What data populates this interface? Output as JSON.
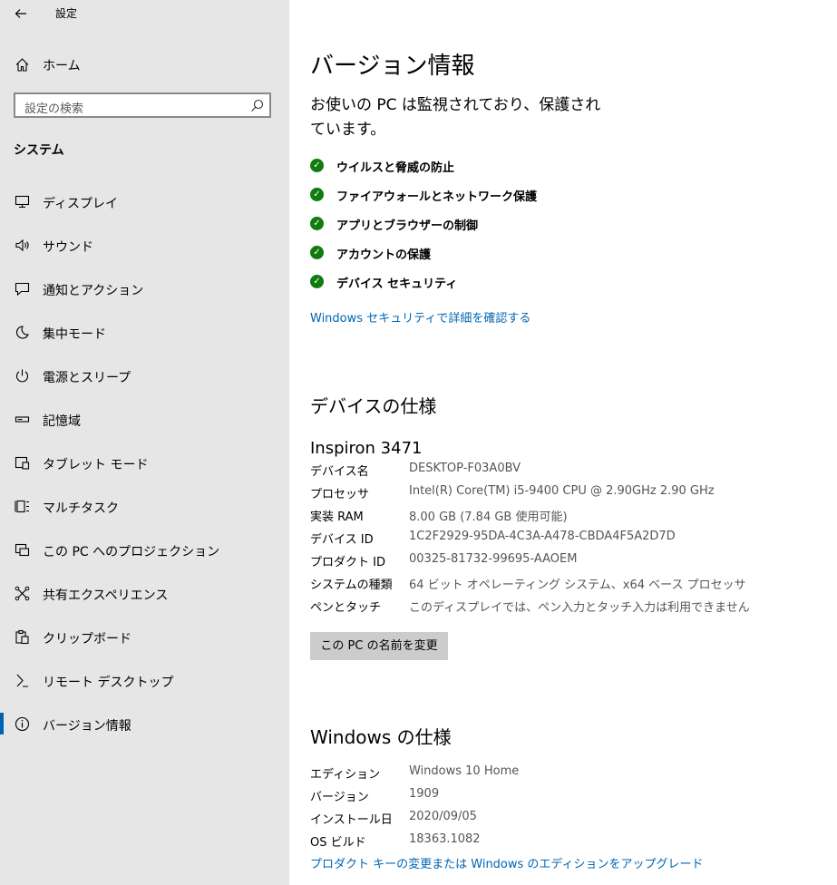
{
  "window": {
    "title": "設定"
  },
  "sidebar": {
    "home_label": "ホーム",
    "search_placeholder": "設定の検索",
    "section": "システム",
    "items": [
      {
        "label": "ディスプレイ",
        "icon": "display-icon"
      },
      {
        "label": "サウンド",
        "icon": "speaker-icon"
      },
      {
        "label": "通知とアクション",
        "icon": "notification-icon"
      },
      {
        "label": "集中モード",
        "icon": "moon-icon"
      },
      {
        "label": "電源とスリープ",
        "icon": "power-icon"
      },
      {
        "label": "記憶域",
        "icon": "storage-icon"
      },
      {
        "label": "タブレット モード",
        "icon": "tablet-icon"
      },
      {
        "label": "マルチタスク",
        "icon": "multitask-icon"
      },
      {
        "label": "この PC へのプロジェクション",
        "icon": "projection-icon"
      },
      {
        "label": "共有エクスペリエンス",
        "icon": "share-icon"
      },
      {
        "label": "クリップボード",
        "icon": "clipboard-icon"
      },
      {
        "label": "リモート デスクトップ",
        "icon": "remote-icon"
      },
      {
        "label": "バージョン情報",
        "icon": "info-icon",
        "active": true
      }
    ]
  },
  "main": {
    "title": "バージョン情報",
    "protection_line1": "お使いの PC は監視されており、保護され",
    "protection_line2": "ています。",
    "security_items": [
      "ウイルスと脅威の防止",
      "ファイアウォールとネットワーク保護",
      "アプリとブラウザーの制御",
      "アカウントの保護",
      "デバイス セキュリティ"
    ],
    "security_link": "Windows セキュリティで詳細を確認する",
    "device_spec_heading": "デバイスの仕様",
    "model": "Inspiron 3471",
    "device_specs": [
      {
        "label": "デバイス名",
        "value": "DESKTOP-F03A0BV"
      },
      {
        "label": "プロセッサ",
        "value": "Intel(R) Core(TM) i5-9400 CPU @ 2.90GHz   2.90 GHz"
      },
      {
        "label": "実装 RAM",
        "value": "8.00 GB (7.84 GB 使用可能)"
      },
      {
        "label": "デバイス ID",
        "value": "1C2F2929-95DA-4C3A-A478-CBDA4F5A2D7D"
      },
      {
        "label": "プロダクト ID",
        "value": "00325-81732-99695-AAOEM"
      },
      {
        "label": "システムの種類",
        "value": "64 ビット オペレーティング システム、x64 ベース プロセッサ"
      },
      {
        "label": "ペンとタッチ",
        "value": "このディスプレイでは、ペン入力とタッチ入力は利用できません"
      }
    ],
    "rename_button": "この PC の名前を変更",
    "windows_spec_heading": "Windows の仕様",
    "windows_specs": [
      {
        "label": "エディション",
        "value": "Windows 10 Home"
      },
      {
        "label": "バージョン",
        "value": "1909"
      },
      {
        "label": "インストール日",
        "value": "2020/09/05"
      },
      {
        "label": "OS ビルド",
        "value": "18363.1082"
      }
    ],
    "upgrade_link": "プロダクト キーの変更または Windows のエディションをアップグレード"
  },
  "colors": {
    "accent": "#0063b1",
    "link": "#0066b4",
    "check": "#107c10",
    "sidebar_bg": "#e6e6e6",
    "button_bg": "#cccccc"
  }
}
